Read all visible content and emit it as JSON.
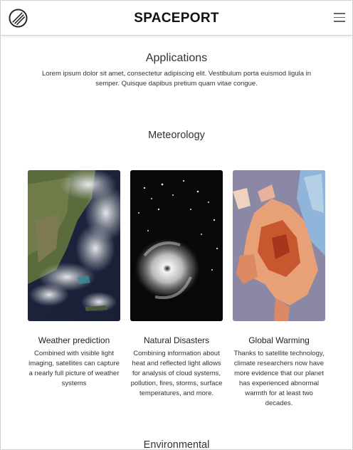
{
  "navbar": {
    "brand": "SPACEPORT",
    "logo_icon": "planet-logo-icon",
    "menu_icon": "hamburger-menu-icon"
  },
  "applications": {
    "heading": "Applications",
    "description": "Lorem ipsum dolor sit amet, consectetur adipiscing elit. Vestibulum porta euismod ligula in semper. Quisque dapibus pretium quam vitae congue."
  },
  "meteorology": {
    "heading": "Meteorology",
    "cards": [
      {
        "title": "Weather prediction",
        "description": "Combined with visible light imaging, satellites can capture a nearly full picture of weather systems",
        "image": "satellite-earth-clouds-image"
      },
      {
        "title": "Natural Disasters",
        "description": "Combining information about heat and reflected light allows for analysis of cloud systems, pollution, fires, storms, surface temperatures, and more.",
        "image": "hurricane-night-image"
      },
      {
        "title": "Global Warming",
        "description": "Thanks to satellite technology, climate researchers now have more evidence that our planet has experienced abnormal warmth for at least two decades.",
        "image": "europe-temperature-map-image"
      }
    ]
  },
  "environmental": {
    "heading": "Environmental"
  },
  "colors": {
    "background": "#ffffff",
    "text": "#222222",
    "navbar_border": "#d6d6d6"
  }
}
